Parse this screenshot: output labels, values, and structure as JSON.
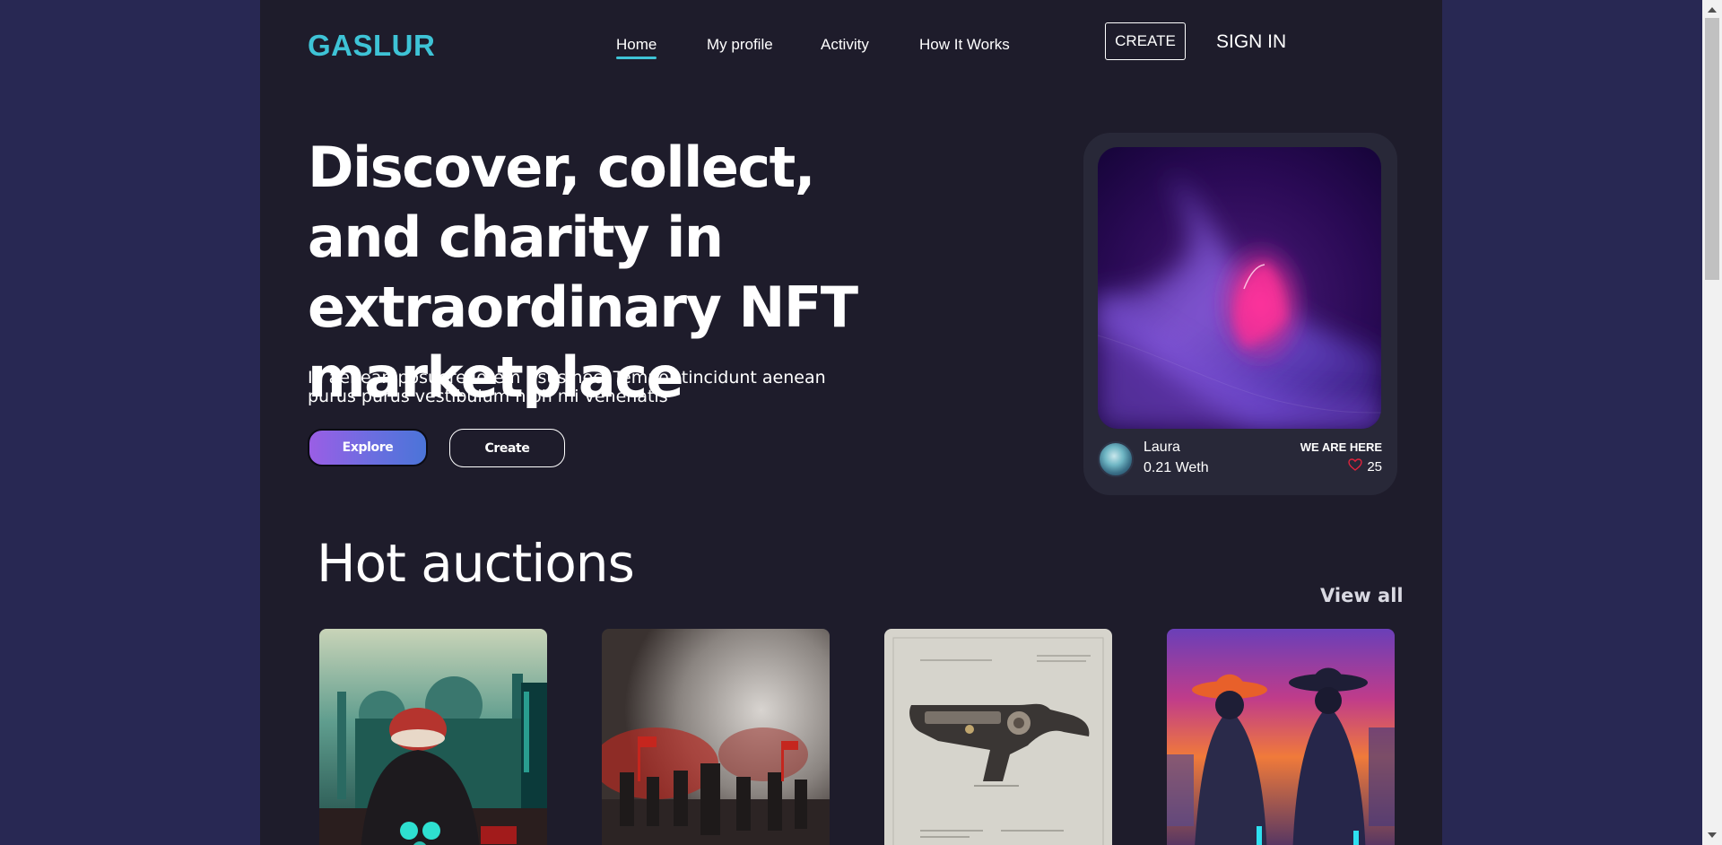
{
  "brand": {
    "logo": "GASLUR",
    "accent_color": "#3ec3d6"
  },
  "nav": {
    "items": [
      {
        "label": "Home",
        "active": true
      },
      {
        "label": "My profile",
        "active": false
      },
      {
        "label": "Activity",
        "active": false
      },
      {
        "label": "How It Works",
        "active": false
      }
    ],
    "create_label": "CREATE",
    "signin_label": "SIGN IN"
  },
  "hero": {
    "title": "Discover, collect, and charity in extraordinary NFT marketplace",
    "subtitle": "In aenean posuere lorem risus nec. Tempor tincidunt aenean purus purus vestibulum nibh mi venenatis",
    "explore_label": "Explore",
    "create_label": "Create"
  },
  "featured": {
    "artist": "Laura",
    "price": "0.21 Weth",
    "tag": "WE ARE HERE",
    "likes": "25",
    "like_icon": "heart-icon"
  },
  "auctions": {
    "title": "Hot auctions",
    "view_all_label": "View all",
    "items": [
      {
        "art": "cyberpunk-mosque-figure"
      },
      {
        "art": "red-smoke-crowd"
      },
      {
        "art": "steampunk-pistol-blueprint"
      },
      {
        "art": "neon-cowboys"
      }
    ]
  }
}
